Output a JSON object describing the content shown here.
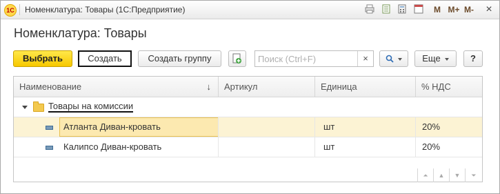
{
  "window": {
    "logo_text": "1С",
    "title": "Номенклатура: Товары  (1С:Предприятие)",
    "icons": [
      "print-icon",
      "document-icon",
      "calculator-icon",
      "calendar-icon"
    ],
    "calendar_day": "31",
    "m_labels": [
      "M",
      "M+",
      "M-"
    ],
    "close_glyph": "×"
  },
  "form": {
    "title": "Номенклатура: Товары"
  },
  "toolbar": {
    "select_label": "Выбрать",
    "create_label": "Создать",
    "create_group_label": "Создать группу",
    "search_placeholder": "Поиск (Ctrl+F)",
    "clear_glyph": "×",
    "more_label": "Еще",
    "help_label": "?"
  },
  "table": {
    "columns": [
      "Наименование",
      "Артикул",
      "Единица",
      "% НДС"
    ],
    "sort_glyph": "↓",
    "group": {
      "name": "Товары на комиссии"
    },
    "rows": [
      {
        "name": "Атланта Диван-кровать",
        "article": "",
        "unit": "шт",
        "vat": "20%"
      },
      {
        "name": "Калипсо Диван-кровать",
        "article": "",
        "unit": "шт",
        "vat": "20%"
      }
    ]
  },
  "nav": [
    "⏶",
    "▲",
    "▼",
    "⏷"
  ]
}
